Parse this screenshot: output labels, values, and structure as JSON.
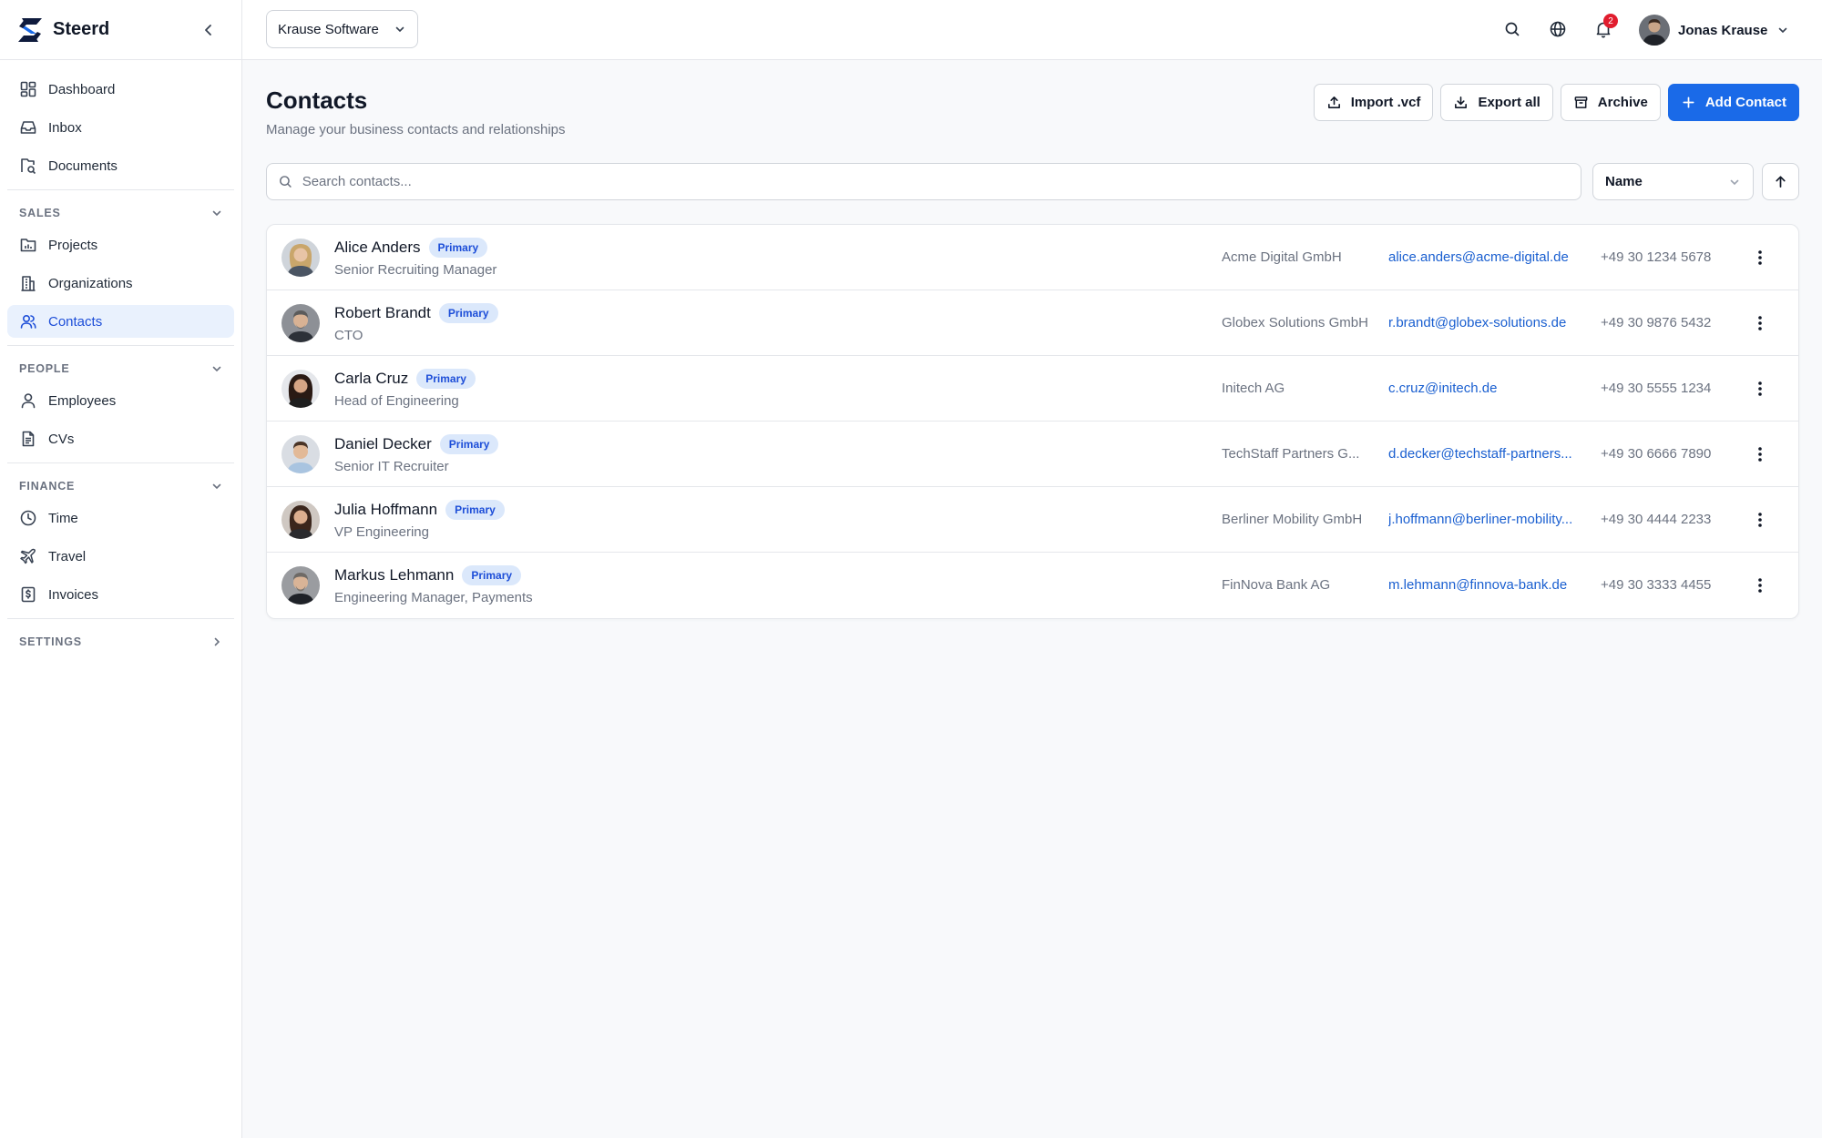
{
  "app": {
    "name": "Steerd"
  },
  "sidebar": {
    "top_items": [
      {
        "label": "Dashboard",
        "icon": "dashboard-icon"
      },
      {
        "label": "Inbox",
        "icon": "inbox-icon"
      },
      {
        "label": "Documents",
        "icon": "documents-icon"
      }
    ],
    "sections": [
      {
        "label": "SALES",
        "items": [
          {
            "label": "Projects",
            "icon": "folder-chart-icon"
          },
          {
            "label": "Organizations",
            "icon": "building-icon"
          },
          {
            "label": "Contacts",
            "icon": "users-icon",
            "active": true
          }
        ]
      },
      {
        "label": "PEOPLE",
        "items": [
          {
            "label": "Employees",
            "icon": "user-icon"
          },
          {
            "label": "CVs",
            "icon": "file-text-icon"
          }
        ]
      },
      {
        "label": "FINANCE",
        "items": [
          {
            "label": "Time",
            "icon": "clock-icon"
          },
          {
            "label": "Travel",
            "icon": "plane-icon"
          },
          {
            "label": "Invoices",
            "icon": "invoice-icon"
          }
        ]
      }
    ],
    "settings_label": "SETTINGS"
  },
  "topbar": {
    "org_name": "Krause Software",
    "notification_count": "2",
    "user_name": "Jonas Krause"
  },
  "page": {
    "title": "Contacts",
    "subtitle": "Manage your business contacts and relationships",
    "actions": {
      "import_label": "Import .vcf",
      "export_label": "Export all",
      "archive_label": "Archive",
      "add_label": "Add Contact"
    },
    "search_placeholder": "Search contacts...",
    "sort_value": "Name"
  },
  "contacts": [
    {
      "name": "Alice Anders",
      "badge": "Primary",
      "role": "Senior Recruiting Manager",
      "company": "Acme Digital GmbH",
      "email": "alice.anders@acme-digital.de",
      "phone": "+49 30 1234 5678"
    },
    {
      "name": "Robert Brandt",
      "badge": "Primary",
      "role": "CTO",
      "company": "Globex Solutions GmbH",
      "email": "r.brandt@globex-solutions.de",
      "phone": "+49 30 9876 5432"
    },
    {
      "name": "Carla Cruz",
      "badge": "Primary",
      "role": "Head of Engineering",
      "company": "Initech AG",
      "email": "c.cruz@initech.de",
      "phone": "+49 30 5555 1234"
    },
    {
      "name": "Daniel Decker",
      "badge": "Primary",
      "role": "Senior IT Recruiter",
      "company": "TechStaff Partners G...",
      "email": "d.decker@techstaff-partners...",
      "phone": "+49 30 6666 7890"
    },
    {
      "name": "Julia Hoffmann",
      "badge": "Primary",
      "role": "VP Engineering",
      "company": "Berliner Mobility GmbH",
      "email": "j.hoffmann@berliner-mobility...",
      "phone": "+49 30 4444 2233"
    },
    {
      "name": "Markus Lehmann",
      "badge": "Primary",
      "role": "Engineering Manager, Payments",
      "company": "FinNova Bank AG",
      "email": "m.lehmann@finnova-bank.de",
      "phone": "+49 30 3333 4455"
    }
  ],
  "colors": {
    "accent": "#1a6ae8",
    "active_bg": "#e9f1fd",
    "badge_bg": "#dbe8fb",
    "notification": "#e11d2e"
  }
}
